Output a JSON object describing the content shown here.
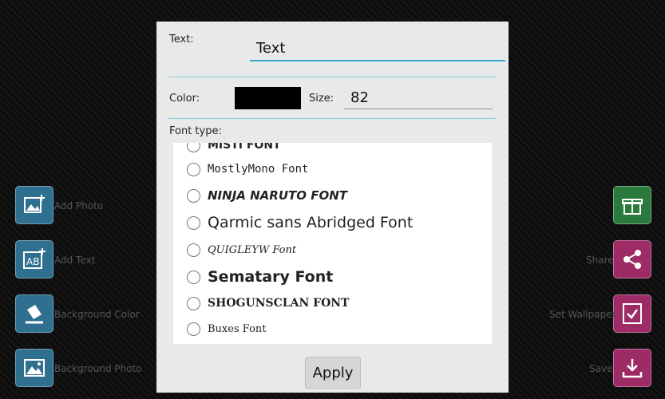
{
  "left_actions": [
    {
      "label": "Add Photo",
      "icon": "image-plus-icon"
    },
    {
      "label": "Add Text",
      "icon": "text-ab-plus-icon"
    },
    {
      "label": "Background Color",
      "icon": "paint-bucket-icon"
    },
    {
      "label": "Background Photo",
      "icon": "landscape-icon"
    }
  ],
  "right_actions": [
    {
      "label": "",
      "icon": "gift-box-icon"
    },
    {
      "label": "Share",
      "icon": "share-icon"
    },
    {
      "label": "Set Wallpaper",
      "icon": "wallpaper-check-icon"
    },
    {
      "label": "Save",
      "icon": "download-icon"
    }
  ],
  "dialog": {
    "text_label": "Text:",
    "text_value": "Text",
    "color_label": "Color:",
    "color_value": "#000000",
    "size_label": "Size:",
    "size_value": "82",
    "font_type_label": "Font type:",
    "fonts": [
      "MISTI FONT",
      "MostlyMono Font",
      "NINJA NARUTO FONT",
      "Qarmic sans Abridged Font",
      "QUIGLEYW Font",
      "Sematary Font",
      "SHOGUNSCLAN FONT",
      "Buxes Font"
    ],
    "apply_label": "Apply"
  },
  "colors": {
    "accent": "#33a5c8",
    "left_button": "#2f6f8f",
    "right_green": "#2b7a3d",
    "right_pink": "#9c2b66"
  }
}
